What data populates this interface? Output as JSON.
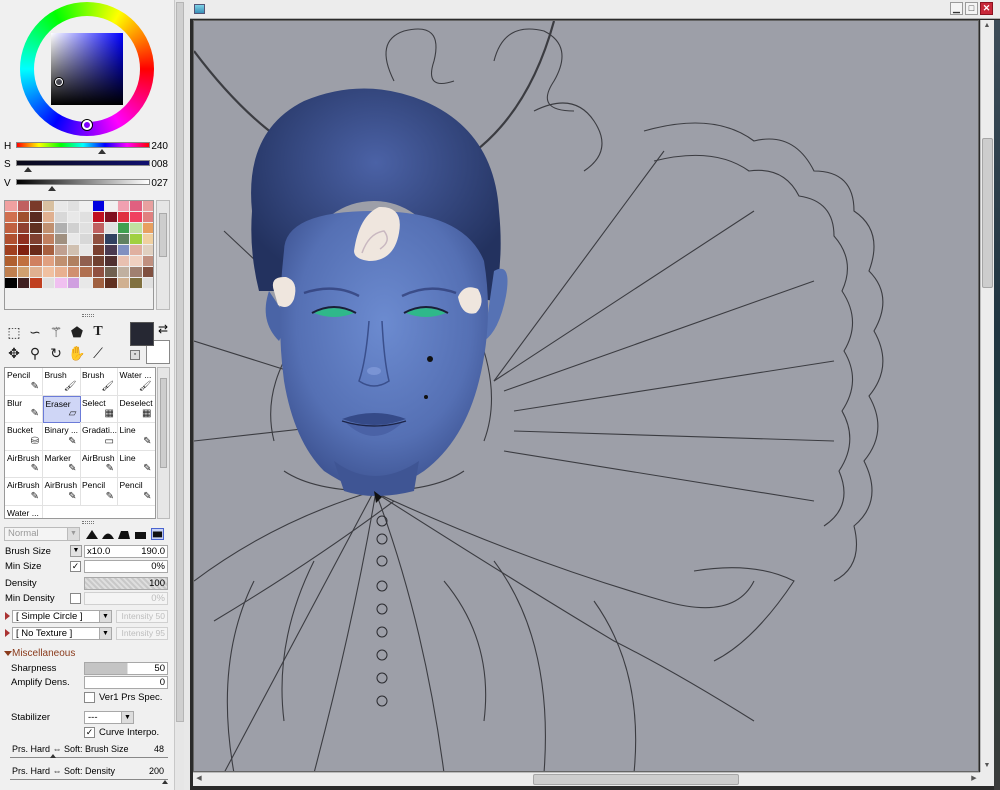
{
  "color": {
    "h_label": "H",
    "h_value": "240",
    "s_label": "S",
    "s_value": "008",
    "v_label": "V",
    "v_value": "027",
    "foreground": "#262833",
    "background": "#ffffff"
  },
  "palette": [
    "#f0a0a0",
    "#c06060",
    "#7a3a2a",
    "#d8c0a0",
    "#e8e8e8",
    "#e0e0e0",
    "#f0f0f0",
    "#0000e0",
    "#f0f0f0",
    "#f0a0b0",
    "#e06080",
    "#e8a0a0",
    "#d07050",
    "#a05030",
    "#5a2a20",
    "#e0b090",
    "#d8d8d8",
    "#e8e8e8",
    "#e0e0e0",
    "#c01020",
    "#801020",
    "#e03040",
    "#f04060",
    "#e08080",
    "#c06040",
    "#904030",
    "#603020",
    "#c09070",
    "#b0b0b0",
    "#d0d0d0",
    "#e0e0e0",
    "#c06060",
    "#e0e0e0",
    "#40a050",
    "#c0e0a0",
    "#e8a060",
    "#b05030",
    "#903020",
    "#804030",
    "#c08060",
    "#a09080",
    "#e8e8e8",
    "#d8d8d8",
    "#905040",
    "#304060",
    "#608060",
    "#a0d040",
    "#f0d0a0",
    "#a04020",
    "#802010",
    "#6a2a1a",
    "#a86040",
    "#c0a090",
    "#d0c0b0",
    "#e8e8e8",
    "#7a4030",
    "#4a3a50",
    "#8090c0",
    "#e0b0a0",
    "#e0d0c0",
    "#b06030",
    "#c07040",
    "#d08060",
    "#e0a080",
    "#c09070",
    "#b08060",
    "#906050",
    "#704030",
    "#503030",
    "#e8c0b0",
    "#f0d0c0",
    "#c09080",
    "#c08050",
    "#d0a070",
    "#e0b090",
    "#f0c0a0",
    "#e8b090",
    "#d09070",
    "#b07050",
    "#905040",
    "#706050",
    "#c0b0a0",
    "#a08070",
    "#805040",
    "#000000",
    "#402020",
    "#c04020",
    "#e0e0e0",
    "#f0c0f0",
    "#d0a0e0",
    "#e8e8e8",
    "#a06040",
    "#603020",
    "#d0b090",
    "#807040",
    "#e0e0e0"
  ],
  "brushes": [
    {
      "name": "Pencil",
      "icon": "✎"
    },
    {
      "name": "Brush",
      "icon": "🖌"
    },
    {
      "name": "Brush",
      "icon": "🖌"
    },
    {
      "name": "Water ...",
      "icon": "🖌"
    },
    {
      "name": "Blur",
      "icon": "✎"
    },
    {
      "name": "Eraser",
      "icon": "▱"
    },
    {
      "name": "Select",
      "icon": "▦"
    },
    {
      "name": "Deselect",
      "icon": "▦"
    },
    {
      "name": "Bucket",
      "icon": "⛁"
    },
    {
      "name": "Binary ...",
      "icon": "✎"
    },
    {
      "name": "Gradati...",
      "icon": "▭"
    },
    {
      "name": "Line",
      "icon": "✎"
    },
    {
      "name": "AirBrush",
      "icon": "✎"
    },
    {
      "name": "Marker",
      "icon": "✎"
    },
    {
      "name": "AirBrush",
      "icon": "✎"
    },
    {
      "name": "Line",
      "icon": "✎"
    },
    {
      "name": "AirBrush",
      "icon": "✎"
    },
    {
      "name": "AirBrush",
      "icon": "✎"
    },
    {
      "name": "Pencil",
      "icon": "✎"
    },
    {
      "name": "Pencil",
      "icon": "✎"
    },
    {
      "name": "Water ...",
      "icon": ""
    }
  ],
  "blend_mode": "Normal",
  "props": {
    "brush_size_label": "Brush Size",
    "brush_size_mult": "x10.0",
    "brush_size_value": "190.0",
    "min_size_label": "Min Size",
    "min_size_value": "0%",
    "density_label": "Density",
    "density_value": "100",
    "min_density_label": "Min Density",
    "min_density_value": "0%",
    "shape": "[ Simple Circle ]",
    "shape_intensity": "Intensity 50",
    "texture": "[ No Texture ]",
    "texture_intensity": "Intensity 95",
    "misc_label": "Miscellaneous",
    "sharpness_label": "Sharpness",
    "sharpness_value": "50",
    "amplify_label": "Amplify Dens.",
    "amplify_value": "0",
    "ver1_label": "Ver1 Prs Spec.",
    "stabilizer_label": "Stabilizer",
    "stabilizer_value": "---",
    "curve_label": "Curve Interpo.",
    "prs_size_label": "Prs. Hard ⇔ Soft: Brush Size",
    "prs_size_value": "48",
    "prs_density_label": "Prs. Hard ⇔ Soft: Density",
    "prs_density_value": "200"
  },
  "window": {
    "minimize": "▁",
    "maximize": "□",
    "close": "✕"
  },
  "art": {
    "skin": "#5a78b8",
    "skin_shadow": "#3d5592",
    "hair": "#2b3b72",
    "hair_light": "#4c63a8",
    "curl": "#efe6de",
    "eye_green": "#2fb88a",
    "sketch": "#2b2b30",
    "canvas_bg": "#9d9fa8"
  }
}
